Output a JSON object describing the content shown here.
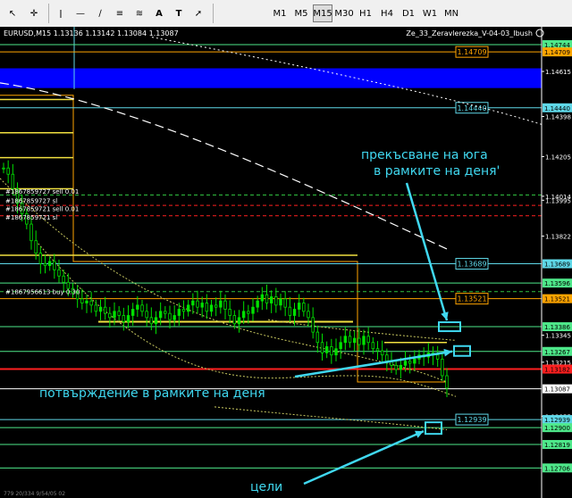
{
  "toolbar": {
    "timeframes": [
      "M1",
      "M5",
      "M15",
      "M30",
      "H1",
      "H4",
      "D1",
      "W1",
      "MN"
    ],
    "active_timeframe": "M15",
    "icons": [
      "cursor-icon",
      "crosshair-icon",
      "vertical-line-icon",
      "horizontal-line-icon",
      "trendline-icon",
      "channel-icon",
      "fibonacci-icon",
      "text-icon",
      "label-icon",
      "arrow-icon"
    ]
  },
  "header": {
    "symbol_info": "EURUSD,M15  1.13136 1.13142 1.13084 1.13087",
    "indicator": "Ze_33_Zeravlerezka_V-04-03_Ibush"
  },
  "orders": [
    {
      "label": "#1867859727 sell 0.01",
      "price": 1.1404
    },
    {
      "label": "#1867859727 sl",
      "price": 1.13995
    },
    {
      "label": "#1867859721 sell 0.01",
      "price": 1.13955
    },
    {
      "label": "#1867859721 sl",
      "price": 1.13915
    },
    {
      "label": "#1867956613 buy 0.30",
      "price": 1.13555
    }
  ],
  "annotations": {
    "breakout": "прекъсване на юга в рамките на деня'",
    "confirm": "потвърждение в рамките на деня",
    "targets": "цели"
  },
  "footer_text": "779  20/334  9/54/05 02",
  "colors": {
    "bg": "#000000",
    "up": "#00e000",
    "down": "#00e000",
    "zone_blue": "#0000ff",
    "cyan": "#5fd8e8",
    "green": "#4ee88a",
    "orange": "#ffa500",
    "yellow": "#f0e040",
    "red": "#ff2020",
    "annotation": "#40d8f0"
  },
  "chart_data": {
    "type": "candlestick",
    "symbol": "EURUSD",
    "timeframe": "M15",
    "ohlc_last": {
      "open": 1.13136,
      "high": 1.13142,
      "low": 1.13084,
      "close": 1.13087
    },
    "ylim": [
      1.1263,
      1.1483
    ],
    "y_ticks": [
      1.14744,
      1.14709,
      1.14615,
      1.1444,
      1.14398,
      1.14205,
      1.14014,
      1.13995,
      1.13822,
      1.13689,
      1.13596,
      1.13521,
      1.13386,
      1.13345,
      1.13267,
      1.13215,
      1.13182,
      1.13087,
      1.12955,
      1.12939,
      1.129,
      1.12819,
      1.12706
    ],
    "price_levels": [
      {
        "price": 1.14744,
        "color": "#4ee88a",
        "label": "1.14744"
      },
      {
        "price": 1.14709,
        "color": "#ffa500",
        "label": "1.14709"
      },
      {
        "price": 1.1444,
        "color": "#5fd8e8",
        "label": "1.14440"
      },
      {
        "price": 1.13689,
        "color": "#5fd8e8",
        "label": "1.13689"
      },
      {
        "price": 1.13596,
        "color": "#4ee88a",
        "label": "1.13596"
      },
      {
        "price": 1.13521,
        "color": "#ffa500",
        "label": "1.13521"
      },
      {
        "price": 1.13386,
        "color": "#4ee88a",
        "label": "1.13386"
      },
      {
        "price": 1.13267,
        "color": "#4ee88a",
        "label": "1.13267"
      },
      {
        "price": 1.13182,
        "color": "#ff2020",
        "label": "1.13182"
      },
      {
        "price": 1.13087,
        "color": "#ffffff",
        "label": "1.13087"
      },
      {
        "price": 1.12939,
        "color": "#5fd8e8",
        "label": "1.12939"
      },
      {
        "price": 1.129,
        "color": "#4ee88a",
        "label": "1.12900"
      },
      {
        "price": 1.12819,
        "color": "#4ee88a",
        "label": "1.12819"
      },
      {
        "price": 1.12706,
        "color": "#4ee88a",
        "label": "1.12706"
      }
    ],
    "closes": [
      1.1415,
      1.1412,
      1.1405,
      1.1398,
      1.1393,
      1.1388,
      1.138,
      1.1374,
      1.1369,
      1.1368,
      1.137,
      1.1366,
      1.1363,
      1.136,
      1.1357,
      1.1355,
      1.1352,
      1.135,
      1.1351,
      1.1349,
      1.1346,
      1.1348,
      1.1345,
      1.1343,
      1.1346,
      1.1344,
      1.1341,
      1.1344,
      1.1347,
      1.1349,
      1.1346,
      1.1343,
      1.134,
      1.1343,
      1.1346,
      1.1345,
      1.1342,
      1.1344,
      1.1347,
      1.1346,
      1.1349,
      1.1351,
      1.1348,
      1.135,
      1.1346,
      1.1349,
      1.1348,
      1.1351,
      1.1347,
      1.1344,
      1.134,
      1.1343,
      1.1346,
      1.1345,
      1.1348,
      1.1351,
      1.1354,
      1.135,
      1.1353,
      1.1349,
      1.1352,
      1.1348,
      1.1344,
      1.1347,
      1.135,
      1.1346,
      1.1343,
      1.1336,
      1.1331,
      1.1326,
      1.1329,
      1.1325,
      1.1328,
      1.1331,
      1.1334,
      1.1331,
      1.1333,
      1.133,
      1.1334,
      1.1331,
      1.1328,
      1.1327,
      1.1325,
      1.1322,
      1.132,
      1.1318,
      1.132,
      1.1322,
      1.1321,
      1.1323,
      1.1325,
      1.1324,
      1.1326,
      1.1325,
      1.1323,
      1.1315,
      1.1309
    ]
  }
}
